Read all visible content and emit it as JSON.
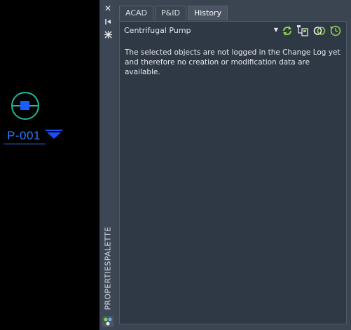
{
  "canvas": {
    "tag": "P-001"
  },
  "palette": {
    "title": "PROPERTIESPALETTE",
    "strip_icons": [
      "close-icon",
      "auto-hide-icon",
      "settings-icon"
    ]
  },
  "tabs": [
    {
      "label": "ACAD"
    },
    {
      "label": "P&ID"
    },
    {
      "label": "History"
    }
  ],
  "active_tab": "History",
  "object_select": {
    "value": "Centrifugal Pump"
  },
  "toolbar_icons": [
    "refresh-icon",
    "select-objects-icon",
    "compare-icon",
    "history-icon"
  ],
  "message": "The selected objects are not logged in the Change Log yet and therefore no creation or modification data are available.",
  "colors": {
    "tag_blue": "#2f7bff",
    "pump_green": "#1fb89a",
    "panel_bg": "#3b4451",
    "content_bg": "#2f3945"
  }
}
